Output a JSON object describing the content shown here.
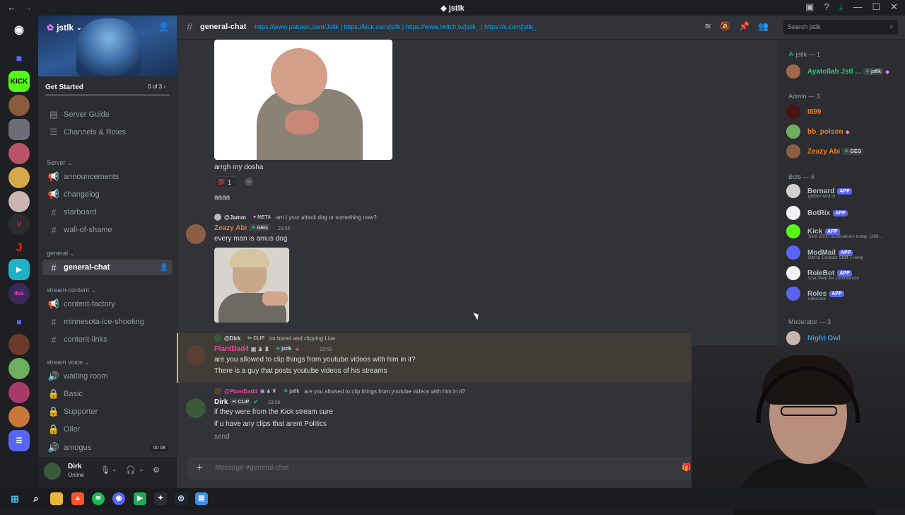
{
  "window": {
    "title": "jstlk",
    "back": "←",
    "forward": "→"
  },
  "server": {
    "name": "jstlk",
    "get_started": "Get Started",
    "get_started_progress": "0 of 3"
  },
  "sidebar": {
    "top_items": [
      {
        "label": "Server Guide",
        "icon": "server-guide-icon"
      },
      {
        "label": "Channels & Roles",
        "icon": "channels-roles-icon"
      }
    ],
    "categories": [
      {
        "label": "Server",
        "channels": [
          {
            "label": "announcements",
            "icon": "megaphone-icon"
          },
          {
            "label": "changelog",
            "icon": "megaphone-icon"
          },
          {
            "label": "starboard",
            "icon": "hash-icon"
          },
          {
            "label": "wall-of-shame",
            "icon": "hash-icon"
          }
        ]
      },
      {
        "label": "general",
        "channels": [
          {
            "label": "general-chat",
            "icon": "hash-icon",
            "active": true
          }
        ]
      },
      {
        "label": "stream-content",
        "channels": [
          {
            "label": "content-factory",
            "icon": "megaphone-icon"
          },
          {
            "label": "minnesota-ice-shooting",
            "icon": "hash-icon"
          },
          {
            "label": "content-links",
            "icon": "hash-icon"
          }
        ]
      },
      {
        "label": "stream voice",
        "channels": [
          {
            "label": "waiting room",
            "icon": "speaker-icon"
          },
          {
            "label": "Basic",
            "icon": "lock-icon"
          },
          {
            "label": "Supporter",
            "icon": "lock-icon"
          },
          {
            "label": "Oiler",
            "icon": "lock-icon"
          },
          {
            "label": "amogus",
            "icon": "speaker-icon",
            "badge_left": "00",
            "badge_right": "08"
          }
        ]
      }
    ]
  },
  "user": {
    "name": "Dirk",
    "status": "Online"
  },
  "channel": {
    "name": "general-chat",
    "topic": "https://www.patreon.com/Jstlk | https://kick.com/jstlk | https://www.twitch.tv/jstlk_ | https://x.com/jstlk_"
  },
  "search": {
    "placeholder": "Search jstlk"
  },
  "messages": {
    "m1_text": "arrgh my dosha",
    "m1_reaction_count": "1",
    "m2_text": "aaaa",
    "m3_reply_name": "@Jamm",
    "m3_reply_tag": "META",
    "m3_reply_text": "am I your attack dog or something now?",
    "m3_author": "Zeazy Abi",
    "m3_author_tag": "GEG",
    "m3_time": "23:56",
    "m3_text": "every man is amus dog",
    "m4_reply_name": "@Dirk",
    "m4_reply_tag": "CLIP",
    "m4_reply_text": "im bored and clipping Live",
    "m4_author": "PlantDad4",
    "m4_author_tag": "jstlk",
    "m4_time": "23:56",
    "m4_text1": "are you allowed to clip things from youtube videos with him in it?",
    "m4_text2": "There is a guy that posts youtube videos of his streams",
    "m5_reply_name": "@PlantDad4",
    "m5_reply_tag": "jstlk",
    "m5_reply_text": "are you allowed to clip things from youtube videos with him in it?",
    "m5_author": "Dirk",
    "m5_author_tag": "CLIP",
    "m5_time": "23:56",
    "m5_text1": "if they were from the Kick stream sure",
    "m5_text2": "if u have any clips that arent Politics",
    "m5_text3": "send"
  },
  "composer": {
    "placeholder": "Message #general-chat"
  },
  "members": {
    "cat_owner": "jstlk — 1",
    "cat_admin": "Admin — 3",
    "cat_bots": "Bots — 6",
    "cat_mod": "Moderator — 3",
    "owner": {
      "name": "Ayatollah Jstl ...",
      "tag": "jstlk"
    },
    "admins": [
      {
        "name": "I899",
        "color": "#e67e22"
      },
      {
        "name": "bb_poison",
        "color": "#e67e22"
      },
      {
        "name": "Zeazy Abi",
        "color": "#e67e22",
        "tag": "GEG"
      }
    ],
    "bots": [
      {
        "name": "Bernard",
        "tag": "APP",
        "sub": "getbernard.io"
      },
      {
        "name": "BotRix",
        "tag": "APP",
        "sub": ""
      },
      {
        "name": "Kick",
        "tag": "APP",
        "sub": "Sent 3500 notifications today. (388..."
      },
      {
        "name": "ModMail",
        "tag": "APP",
        "sub": "DM to Contact Staff | =help"
      },
      {
        "name": "RoleBot",
        "tag": "APP",
        "sub": "Use /help for commands!"
      },
      {
        "name": "Roles",
        "tag": "APP",
        "sub": "roles.bot"
      }
    ],
    "mods": [
      {
        "name": "Night Owl"
      }
    ]
  },
  "colors": {
    "accent": "#5865f2",
    "link": "#00a8fc",
    "owner_name": "#2dc770",
    "admin_name": "#e67e22",
    "mention_bg": "#f0b232",
    "bot_name": "#b5bac1",
    "mod_name": "#3498db"
  }
}
